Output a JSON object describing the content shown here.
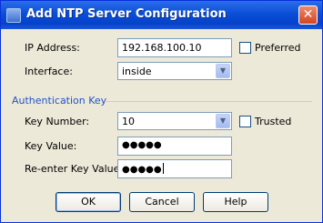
{
  "window": {
    "title": "Add NTP Server Configuration",
    "close_glyph": "✕"
  },
  "form": {
    "ip_address": {
      "label": "IP Address:",
      "value": "192.168.100.10"
    },
    "preferred": {
      "label": "Preferred",
      "checked": false
    },
    "interface": {
      "label": "Interface:",
      "value": "inside"
    }
  },
  "auth": {
    "group_title": "Authentication Key",
    "key_number": {
      "label": "Key Number:",
      "value": "10"
    },
    "trusted": {
      "label": "Trusted",
      "checked": false
    },
    "key_value": {
      "label": "Key Value:",
      "value": "●●●●●"
    },
    "reenter_key_value": {
      "label": "Re-enter Key Value:",
      "value": "●●●●●"
    }
  },
  "buttons": {
    "ok": "OK",
    "cancel": "Cancel",
    "help": "Help"
  },
  "icons": {
    "dropdown": "▼"
  },
  "colors": {
    "titlebar": "#0a4fd8",
    "dialog_bg": "#ece9d8",
    "group_title": "#2054c8",
    "close_button": "#d6441f"
  }
}
